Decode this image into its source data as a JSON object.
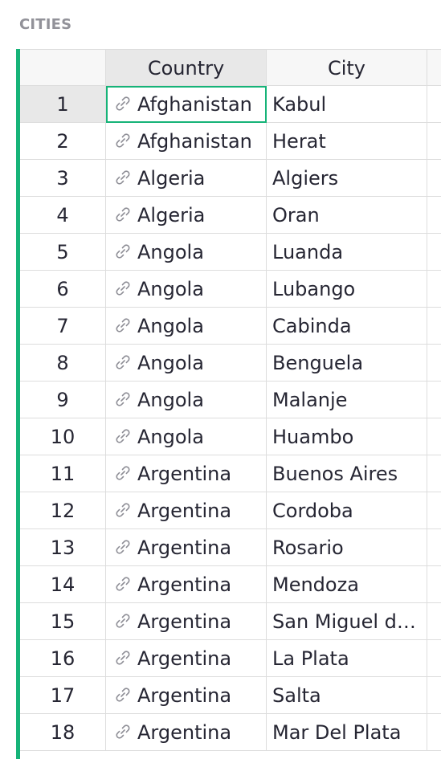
{
  "section": {
    "title": "CITIES"
  },
  "table": {
    "columns": [
      "Country",
      "City"
    ],
    "rows": [
      {
        "num": "1",
        "country": "Afghanistan",
        "city": "Kabul"
      },
      {
        "num": "2",
        "country": "Afghanistan",
        "city": "Herat"
      },
      {
        "num": "3",
        "country": "Algeria",
        "city": "Algiers"
      },
      {
        "num": "4",
        "country": "Algeria",
        "city": "Oran"
      },
      {
        "num": "5",
        "country": "Angola",
        "city": "Luanda"
      },
      {
        "num": "6",
        "country": "Angola",
        "city": "Lubango"
      },
      {
        "num": "7",
        "country": "Angola",
        "city": "Cabinda"
      },
      {
        "num": "8",
        "country": "Angola",
        "city": "Benguela"
      },
      {
        "num": "9",
        "country": "Angola",
        "city": "Malanje"
      },
      {
        "num": "10",
        "country": "Angola",
        "city": "Huambo"
      },
      {
        "num": "11",
        "country": "Argentina",
        "city": "Buenos Aires"
      },
      {
        "num": "12",
        "country": "Argentina",
        "city": "Cordoba"
      },
      {
        "num": "13",
        "country": "Argentina",
        "city": "Rosario"
      },
      {
        "num": "14",
        "country": "Argentina",
        "city": "Mendoza"
      },
      {
        "num": "15",
        "country": "Argentina",
        "city": "San Miguel de Tucuman"
      },
      {
        "num": "16",
        "country": "Argentina",
        "city": "La Plata"
      },
      {
        "num": "17",
        "country": "Argentina",
        "city": "Salta"
      },
      {
        "num": "18",
        "country": "Argentina",
        "city": "Mar Del Plata"
      }
    ],
    "active_row": 0,
    "active_column": "Country",
    "link_icon": "link-icon"
  },
  "colors": {
    "accent": "#16b378",
    "border": "#dddddd",
    "header_bg": "#f7f7f7",
    "selected_bg": "#e8e8e8",
    "title": "#929299"
  }
}
